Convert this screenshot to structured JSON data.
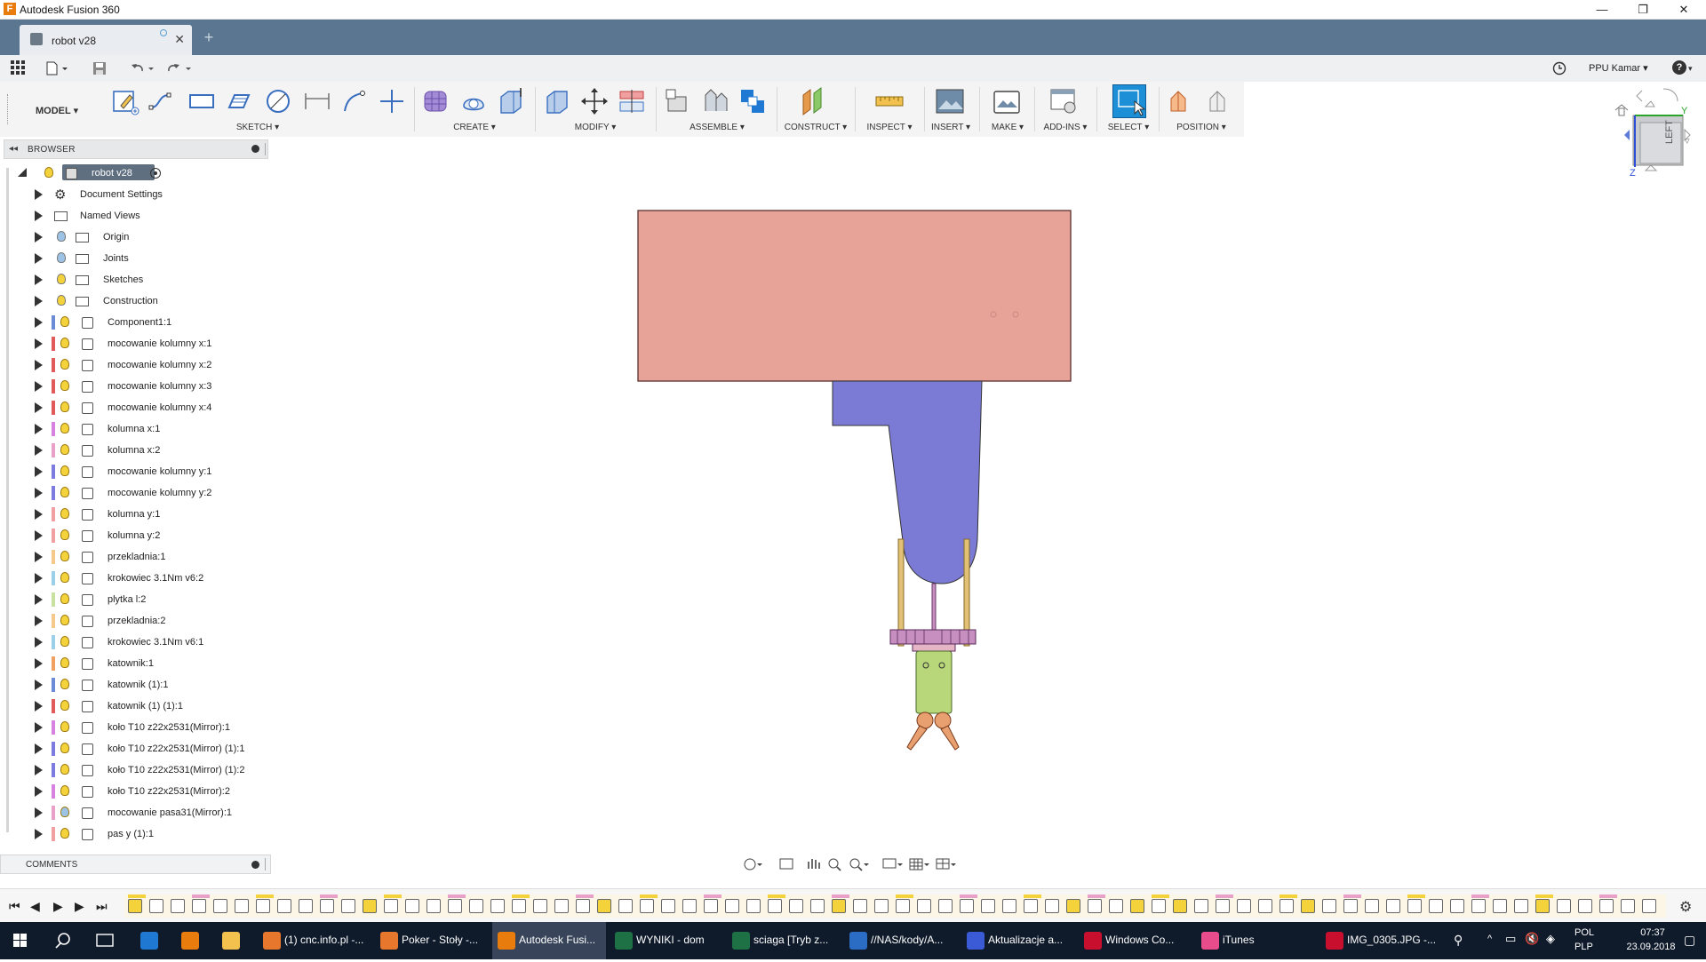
{
  "window": {
    "title": "Autodesk Fusion 360",
    "minimize": "—",
    "maximize": "❐",
    "close": "✕"
  },
  "tab": {
    "label": "robot v28",
    "close": "✕",
    "new_tab": "+"
  },
  "quickbar": {
    "user": "PPU Kamar ▾",
    "help": "?"
  },
  "ribbon": {
    "workspace": "MODEL ▾",
    "groups": [
      "SKETCH ▾",
      "CREATE ▾",
      "MODIFY ▾",
      "ASSEMBLE ▾",
      "CONSTRUCT ▾",
      "INSPECT ▾",
      "INSERT ▾",
      "MAKE ▾",
      "ADD-INS ▾",
      "SELECT ▾",
      "POSITION ▾"
    ]
  },
  "browser": {
    "title": "BROWSER",
    "root": "robot v28",
    "items": [
      {
        "label": "Document Settings",
        "type": "settings"
      },
      {
        "label": "Named Views",
        "type": "folder"
      },
      {
        "label": "Origin",
        "type": "folder",
        "bulb": "#9cc2e5"
      },
      {
        "label": "Joints",
        "type": "folder",
        "bulb": "#9cc2e5"
      },
      {
        "label": "Sketches",
        "type": "folder",
        "bulb": "#f4d23c"
      },
      {
        "label": "Construction",
        "type": "folder",
        "bulb": "#f4d23c"
      },
      {
        "label": "Component1:1",
        "type": "comp",
        "color": "#6b8bd6"
      },
      {
        "label": "mocowanie kolumny x:1",
        "type": "comp",
        "color": "#e05a5a"
      },
      {
        "label": "mocowanie kolumny x:2",
        "type": "comp",
        "color": "#e05a5a"
      },
      {
        "label": "mocowanie kolumny x:3",
        "type": "comp",
        "color": "#e05a5a"
      },
      {
        "label": "mocowanie kolumny x:4",
        "type": "comp",
        "color": "#e05a5a"
      },
      {
        "label": "kolumna x:1",
        "type": "comp",
        "color": "#d782e0"
      },
      {
        "label": "kolumna x:2",
        "type": "comp",
        "color": "#e8a0c8"
      },
      {
        "label": "mocowanie kolumny y:1",
        "type": "comp",
        "color": "#7b7be0"
      },
      {
        "label": "mocowanie kolumny y:2",
        "type": "comp",
        "color": "#7b7be0"
      },
      {
        "label": "kolumna y:1",
        "type": "comp",
        "color": "#f0a0a0"
      },
      {
        "label": "kolumna y:2",
        "type": "comp",
        "color": "#f0a0a0"
      },
      {
        "label": "przekladnia:1",
        "type": "comp",
        "color": "#f5c98a"
      },
      {
        "label": "krokowiec 3.1Nm v6:2",
        "type": "comp",
        "color": "#9ad0e8"
      },
      {
        "label": "plytka l:2",
        "type": "comp",
        "color": "#c8e0a0"
      },
      {
        "label": "przekladnia:2",
        "type": "comp",
        "color": "#f5c98a"
      },
      {
        "label": "krokowiec 3.1Nm v6:1",
        "type": "comp",
        "color": "#9ad0e8"
      },
      {
        "label": "katownik:1",
        "type": "comp",
        "color": "#f0a060"
      },
      {
        "label": "katownik (1):1",
        "type": "comp",
        "color": "#6b8bd6"
      },
      {
        "label": "katownik (1) (1):1",
        "type": "comp",
        "color": "#e05a5a"
      },
      {
        "label": "koło T10 z22x2531(Mirror):1",
        "type": "comp",
        "color": "#d782e0"
      },
      {
        "label": "koło T10 z22x2531(Mirror) (1):1",
        "type": "comp",
        "color": "#7b7be0"
      },
      {
        "label": "koło T10 z22x2531(Mirror) (1):2",
        "type": "comp",
        "color": "#7b7be0"
      },
      {
        "label": "koło T10 z22x2531(Mirror):2",
        "type": "comp",
        "color": "#d782e0"
      },
      {
        "label": "mocowanie pasa31(Mirror):1",
        "type": "comp",
        "color": "#e8a0c8",
        "bulb": "#9cc2e5"
      },
      {
        "label": "pas y (1):1",
        "type": "comp",
        "color": "#f0a0a0"
      }
    ]
  },
  "comments": {
    "title": "COMMENTS"
  },
  "viewcube": {
    "face": "LEFT",
    "axis_y": "Y",
    "axis_z": "Z"
  },
  "taskbar": {
    "items": [
      {
        "label": "(1) cnc.info.pl -...",
        "color": "#e8772e"
      },
      {
        "label": "Poker - Stoły -...",
        "color": "#e8772e"
      },
      {
        "label": "Autodesk Fusi...",
        "color": "#e87d0d",
        "active": true
      },
      {
        "label": "WYNIKI - dom",
        "color": "#1e7145"
      },
      {
        "label": "sciaga  [Tryb z...",
        "color": "#1e7145"
      },
      {
        "label": "//NAS/kody/A...",
        "color": "#2b6cc4"
      },
      {
        "label": "Aktualizacje a...",
        "color": "#3b5bd6"
      },
      {
        "label": "Windows Co...",
        "color": "#c8102e"
      },
      {
        "label": "iTunes",
        "color": "#e84c8b"
      },
      {
        "label": "IMG_0305.JPG -...",
        "color": "#c8102e"
      }
    ],
    "lang_top": "POL",
    "lang_bottom": "PLP",
    "time": "07:37",
    "date": "23.09.2018"
  }
}
